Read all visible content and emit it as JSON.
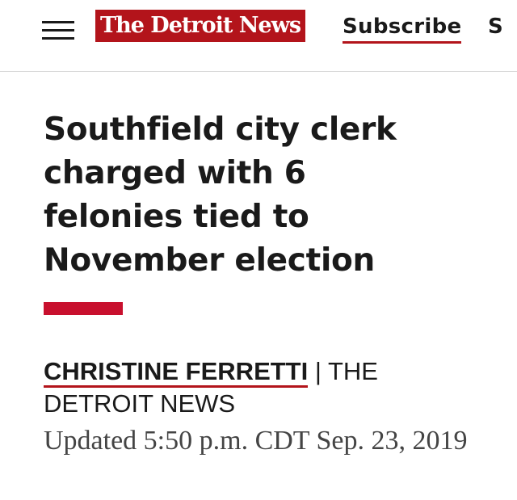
{
  "header": {
    "menu_icon": "hamburger-menu-icon",
    "logo_text": "The Detroit News",
    "subscribe_label": "Subscribe",
    "next_item_label": "S",
    "brand_color": "#b3141b"
  },
  "article": {
    "headline": "Southfield city clerk charged with 6 felonies tied to November election",
    "author": "CHRISTINE FERRETTI",
    "separator": " | ",
    "publication": "THE DETROIT NEWS",
    "updated": "Updated 5:50 p.m. CDT Sep. 23, 2019",
    "accent_color": "#c8102e"
  }
}
